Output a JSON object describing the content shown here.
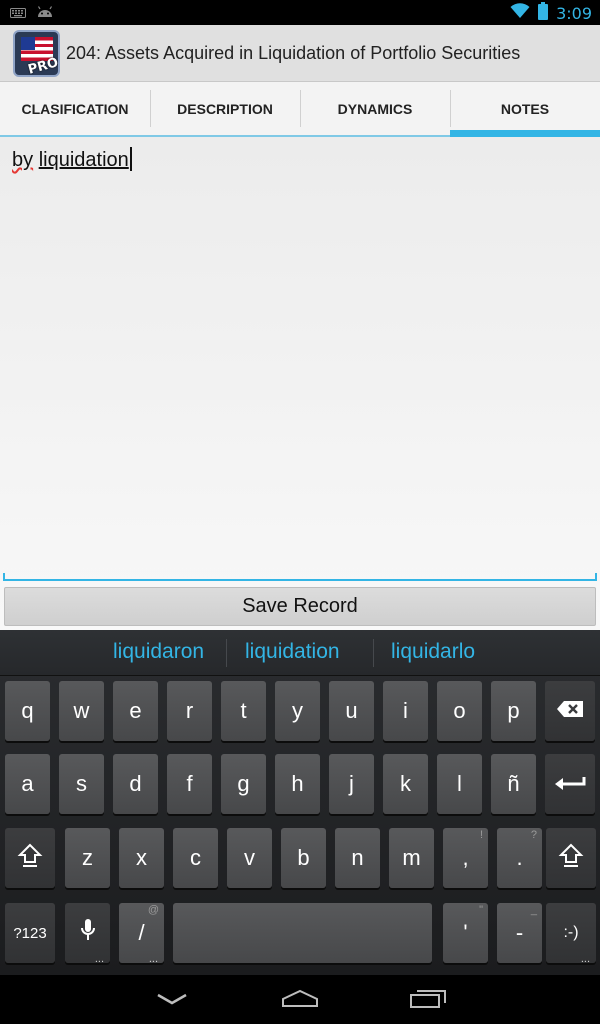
{
  "status_bar": {
    "time": "3:09",
    "left_icons": [
      "keyboard-icon",
      "android-icon"
    ],
    "right_icons": [
      "wifi-icon",
      "battery-icon"
    ]
  },
  "action_bar": {
    "title": "204: Assets Acquired in Liquidation of Portfolio Securities",
    "app_icon_badge": "PRO"
  },
  "tabs": [
    {
      "label": "CLASIFICATION",
      "selected": false
    },
    {
      "label": "DESCRIPTION",
      "selected": false
    },
    {
      "label": "DYNAMICS",
      "selected": false
    },
    {
      "label": "NOTES",
      "selected": true
    }
  ],
  "notes": {
    "word1": "by",
    "word2": "liquidation"
  },
  "save_button": "Save Record",
  "keyboard": {
    "suggestions": [
      "liquidaron",
      "liquidation",
      "liquidarlo"
    ],
    "row1": [
      "q",
      "w",
      "e",
      "r",
      "t",
      "y",
      "u",
      "i",
      "o",
      "p"
    ],
    "row2": [
      "a",
      "s",
      "d",
      "f",
      "g",
      "h",
      "j",
      "k",
      "l",
      "ñ"
    ],
    "row3": [
      "z",
      "x",
      "c",
      "v",
      "b",
      "n",
      "m",
      ",",
      "."
    ],
    "row3_hints": [
      "",
      "",
      "",
      "",
      "",
      "",
      "",
      "!",
      "?"
    ],
    "row4": {
      "symbols_key": "?123",
      "slash_key": "/",
      "slash_hint": "@",
      "apostrophe_key": "'",
      "apostrophe_hint": "\"",
      "dash_key": "-",
      "dash_hint": "_",
      "smiley_key": ":-)",
      "more_dots": "..."
    }
  },
  "colors": {
    "accent": "#33b5e5",
    "spell_error": "#e53935"
  }
}
